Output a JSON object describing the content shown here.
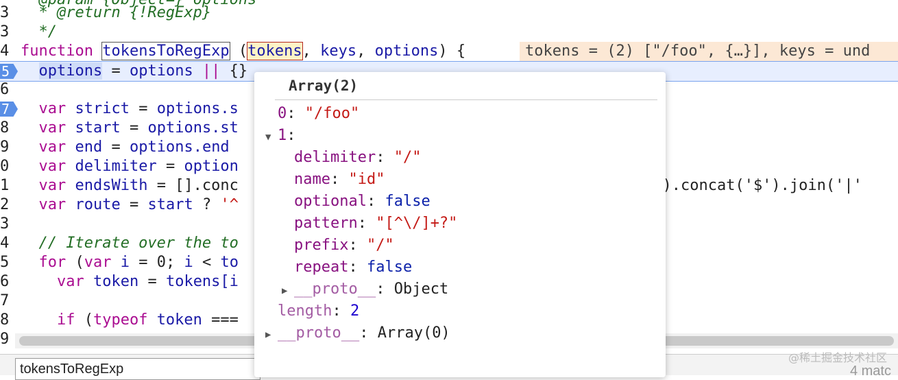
{
  "code_lines": [
    {
      "n": "",
      "parts": [
        [
          "cm",
          "  @param {Object=} options"
        ]
      ]
    },
    {
      "n": "3",
      "parts": [
        [
          "cm",
          "  * @return {!RegExp}"
        ]
      ]
    },
    {
      "n": "3",
      "parts": [
        [
          "cm",
          "  */"
        ]
      ]
    },
    {
      "n": "4",
      "parts": [
        [
          "kw",
          "function "
        ],
        [
          "nm",
          "tokensToRegExp"
        ],
        [
          "plain",
          " ("
        ],
        [
          "nm",
          "tokens"
        ],
        [
          "plain",
          ", "
        ],
        [
          "nm",
          "keys"
        ],
        [
          "plain",
          ", "
        ],
        [
          "nm",
          "options"
        ],
        [
          "plain",
          ") {"
        ]
      ]
    },
    {
      "n": "5",
      "parts": [
        [
          "nm",
          "  options"
        ],
        [
          "plain",
          " = "
        ],
        [
          "nm",
          "options"
        ],
        [
          "op",
          " || "
        ],
        [
          "plain",
          "{}"
        ]
      ]
    },
    {
      "n": "6",
      "parts": []
    },
    {
      "n": "7",
      "parts": [
        [
          "kw",
          "  var "
        ],
        [
          "nm",
          "strict"
        ],
        [
          "plain",
          " = "
        ],
        [
          "nm",
          "options.s"
        ]
      ]
    },
    {
      "n": "8",
      "parts": [
        [
          "kw",
          "  var "
        ],
        [
          "nm",
          "start"
        ],
        [
          "plain",
          " = "
        ],
        [
          "nm",
          "options.st"
        ]
      ]
    },
    {
      "n": "9",
      "parts": [
        [
          "kw",
          "  var "
        ],
        [
          "nm",
          "end"
        ],
        [
          "plain",
          " = "
        ],
        [
          "nm",
          "options.end"
        ]
      ]
    },
    {
      "n": "0",
      "parts": [
        [
          "kw",
          "  var "
        ],
        [
          "nm",
          "delimiter"
        ],
        [
          "plain",
          " = "
        ],
        [
          "nm",
          "option"
        ]
      ]
    },
    {
      "n": "1",
      "parts": [
        [
          "kw",
          "  var "
        ],
        [
          "nm",
          "endsWith"
        ],
        [
          "plain",
          " = [].conc"
        ]
      ]
    },
    {
      "n": "2",
      "parts": [
        [
          "kw",
          "  var "
        ],
        [
          "nm",
          "route"
        ],
        [
          "plain",
          " = "
        ],
        [
          "nm",
          "start"
        ],
        [
          "plain",
          " ? "
        ],
        [
          "str",
          "'^"
        ]
      ]
    },
    {
      "n": "3",
      "parts": []
    },
    {
      "n": "4",
      "parts": [
        [
          "cm",
          "  // Iterate over the to"
        ]
      ]
    },
    {
      "n": "5",
      "parts": [
        [
          "kw",
          "  for "
        ],
        [
          "plain",
          "("
        ],
        [
          "kw",
          "var "
        ],
        [
          "nm",
          "i"
        ],
        [
          "plain",
          " = 0; "
        ],
        [
          "nm",
          "i"
        ],
        [
          "plain",
          " < "
        ],
        [
          "nm",
          "to"
        ]
      ]
    },
    {
      "n": "6",
      "parts": [
        [
          "kw",
          "    var "
        ],
        [
          "nm",
          "token"
        ],
        [
          "plain",
          " = "
        ],
        [
          "nm",
          "tokens[i"
        ]
      ]
    },
    {
      "n": "7",
      "parts": []
    },
    {
      "n": "8",
      "parts": [
        [
          "kw",
          "    if "
        ],
        [
          "plain",
          "("
        ],
        [
          "kw",
          "typeof "
        ],
        [
          "nm",
          "token"
        ],
        [
          "plain",
          " ==="
        ]
      ]
    },
    {
      "n": "9",
      "parts": []
    }
  ],
  "line11_tail": "ng).concat('$').join('|'",
  "inline_value": "tokens = (2) [\"/foo\", {…}], keys = und",
  "popover": {
    "title": "Array(2)",
    "rows": [
      {
        "indent": 0,
        "tri": "",
        "key": "0",
        "sep": ": ",
        "val": "\"/foo\"",
        "vtype": "str"
      },
      {
        "indent": 0,
        "tri": "▼",
        "key": "1",
        "sep": ":",
        "val": "",
        "vtype": "plain"
      },
      {
        "indent": 1,
        "tri": "",
        "key": "delimiter",
        "sep": ": ",
        "val": "\"/\"",
        "vtype": "str"
      },
      {
        "indent": 1,
        "tri": "",
        "key": "name",
        "sep": ": ",
        "val": "\"id\"",
        "vtype": "str"
      },
      {
        "indent": 1,
        "tri": "",
        "key": "optional",
        "sep": ": ",
        "val": "false",
        "vtype": "bool"
      },
      {
        "indent": 1,
        "tri": "",
        "key": "pattern",
        "sep": ": ",
        "val": "\"[^\\/]+?\"",
        "vtype": "str"
      },
      {
        "indent": 1,
        "tri": "",
        "key": "prefix",
        "sep": ": ",
        "val": "\"/\"",
        "vtype": "str"
      },
      {
        "indent": 1,
        "tri": "",
        "key": "repeat",
        "sep": ": ",
        "val": "false",
        "vtype": "bool"
      },
      {
        "indent": 1,
        "tri": "▶",
        "key": "__proto__",
        "sep": ": ",
        "val": "Object",
        "vtype": "plain"
      },
      {
        "indent": 0,
        "tri": "",
        "key": "length",
        "sep": ": ",
        "val": "2",
        "vtype": "num"
      },
      {
        "indent": 0,
        "tri": "▶",
        "key": "__proto__",
        "sep": ": ",
        "val": "Array(0)",
        "vtype": "plain"
      }
    ]
  },
  "search": {
    "value": "tokensToRegExp"
  },
  "matches": "4 matc",
  "watermark": "@稀土掘金技术社区",
  "colors": {
    "highlight_line": "#e7eefe",
    "breakpoint": "#5a8fe6",
    "inline_value_bg": "#fce8d5"
  }
}
